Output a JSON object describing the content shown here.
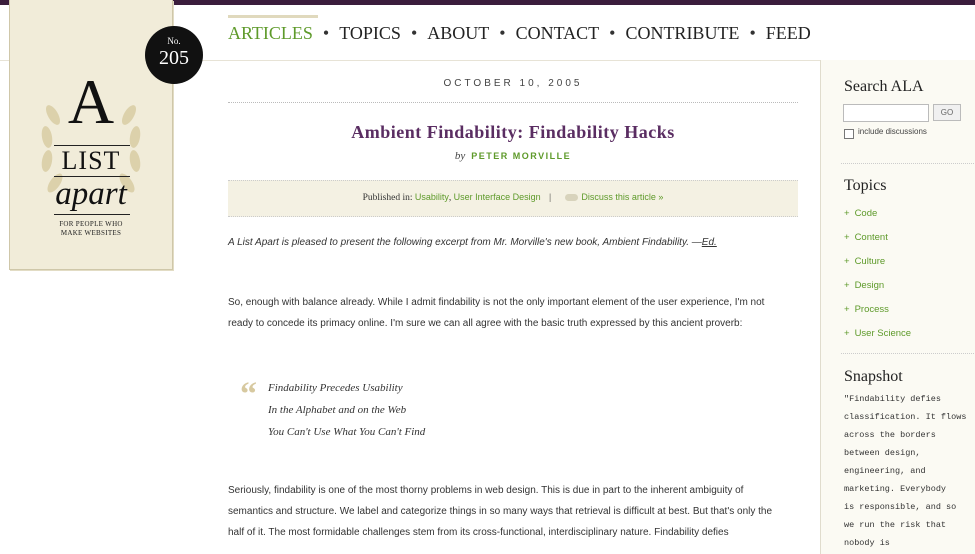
{
  "issue": {
    "prefix": "No.",
    "number": "205"
  },
  "logo": {
    "letter": "A",
    "word1": "LIST",
    "word2": "apart",
    "tagline_1": "FOR PEOPLE WHO",
    "tagline_2": "MAKE WEBSITES"
  },
  "nav": {
    "items": [
      {
        "label": "ARTICLES",
        "active": true
      },
      {
        "label": "TOPICS"
      },
      {
        "label": "ABOUT"
      },
      {
        "label": "CONTACT"
      },
      {
        "label": "CONTRIBUTE"
      },
      {
        "label": "FEED"
      }
    ],
    "separator": "•"
  },
  "article": {
    "date": "OCTOBER 10, 2005",
    "title": "Ambient Findability: Findability Hacks",
    "by": "by",
    "author": "PETER MORVILLE",
    "published_in_label": "Published in:",
    "categories": [
      "Usability",
      "User Interface Design"
    ],
    "category_sep": ",",
    "pipe": "|",
    "discuss_label": "Discuss this article »",
    "intro": "A List Apart is pleased to present the following excerpt from Mr. Morville's new book, Ambient Findability. —",
    "intro_ed": "Ed.",
    "p1": "So, enough with balance already. While I admit findability is not the only important element of the user experience, I'm not ready to concede its primacy online. I'm sure we can all agree with the basic truth expressed by this ancient proverb:",
    "quote_mark": "“",
    "quote_lines": [
      "Findability Precedes Usability",
      "In the Alphabet and on the Web",
      "You Can't Use What You Can't Find"
    ],
    "p2": "Seriously, findability is one of the most thorny problems in web design. This is due in part to the inherent ambiguity of semantics and structure. We label and categorize things in so many ways that retrieval is difficult at best. But that's only the half of it. The most formidable challenges stem from its cross-functional, interdisciplinary nature. Findability defies"
  },
  "sidebar": {
    "search_title": "Search ALA",
    "search_value": "",
    "go_label": "GO",
    "include_label": "include discussions",
    "topics_title": "Topics",
    "topics": [
      "Code",
      "Content",
      "Culture",
      "Design",
      "Process",
      "User Science"
    ],
    "bullet": "+",
    "snapshot_title": "Snapshot",
    "snapshot_lines": [
      "\"Findability defies",
      "classification. It flows",
      "across the borders",
      "between design,",
      "engineering, and",
      "marketing. Everybody",
      "is responsible, and so",
      "we run the risk that",
      "nobody is"
    ]
  },
  "colors": {
    "accent_green": "#5e9a2a",
    "title_purple": "#5a2d62",
    "topbar": "#3b1d3c",
    "logo_bg": "#f1ecd9"
  }
}
